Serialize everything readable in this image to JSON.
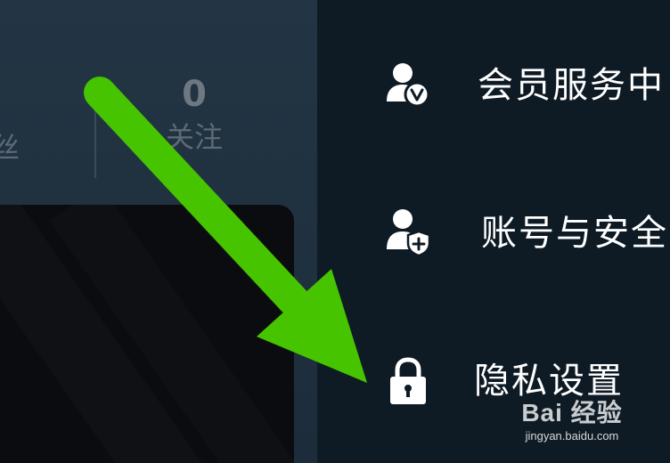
{
  "profile": {
    "fans_label_partial": "丝",
    "follow": {
      "count": "0",
      "label": "关注"
    }
  },
  "menu": {
    "items": [
      {
        "label": "会员服务中",
        "icon": "vip-user-icon"
      },
      {
        "label": "账号与安全",
        "icon": "user-shield-icon"
      },
      {
        "label": "隐私设置",
        "icon": "lock-icon"
      }
    ]
  },
  "annotation": {
    "arrow_color": "#46c400",
    "icon": "green-arrow"
  },
  "watermark": {
    "brand": "Bai 经验",
    "site": "jingyan.baidu.com"
  },
  "colors": {
    "menu_background": "#0e1b25",
    "menu_text": "#ffffff",
    "left_panel": "#233544"
  }
}
